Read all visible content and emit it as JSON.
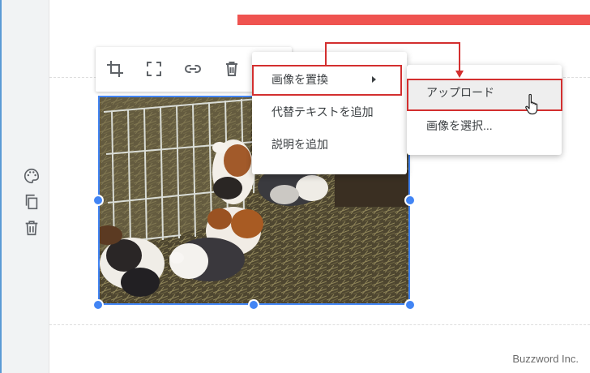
{
  "image_toolbar": {
    "icons": [
      "crop-icon",
      "fullscreen-icon",
      "link-icon",
      "trash-icon"
    ]
  },
  "block_menu": {
    "items": [
      {
        "label": "画像を置換",
        "has_submenu": true,
        "highlighted": true
      },
      {
        "label": "代替テキストを追加"
      },
      {
        "label": "説明を追加"
      }
    ]
  },
  "submenu": {
    "items": [
      {
        "label": "アップロード",
        "highlighted": true
      },
      {
        "label": "画像を選択..."
      }
    ]
  },
  "side_rail": {
    "icons": [
      "palette-icon",
      "copy-icon",
      "trash-icon"
    ]
  },
  "footer": {
    "watermark": "Buzzword Inc."
  },
  "colors": {
    "accent_blue": "#4285f4",
    "highlight_red": "#d32f2f",
    "banner_red": "#ef5350"
  }
}
